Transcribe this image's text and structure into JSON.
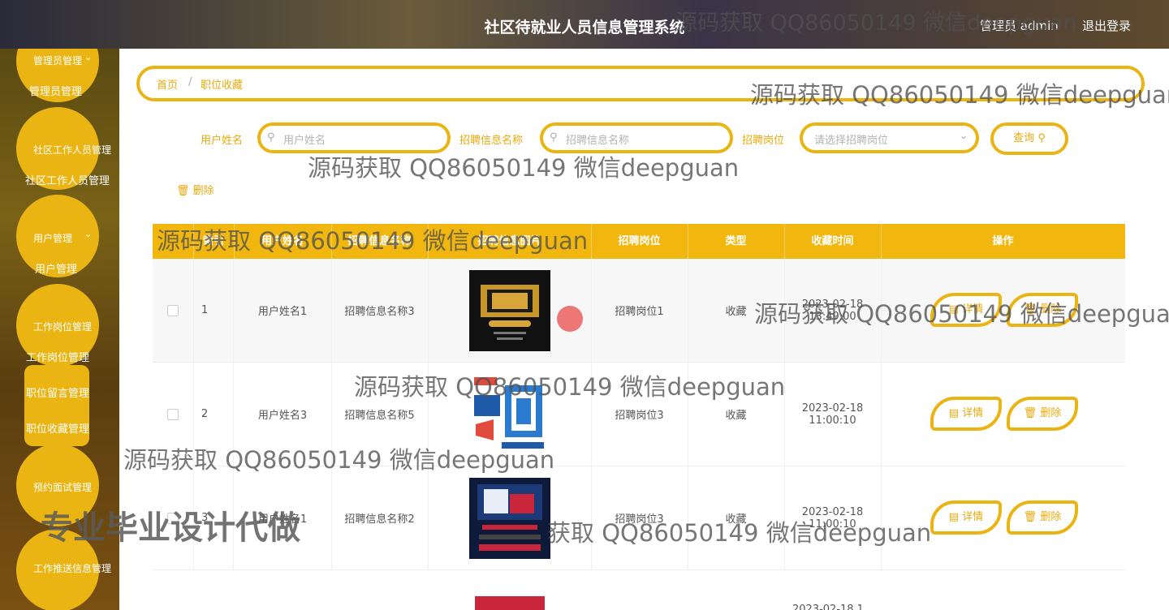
{
  "header": {
    "title": "社区待就业人员信息管理系统",
    "user": "管理员 admin",
    "logout": "退出登录"
  },
  "sidebar": {
    "items": [
      {
        "label": "管理员管理",
        "sub": "管理员管理"
      },
      {
        "label": "社区工作人员管理",
        "sub": "社区工作人员管理"
      },
      {
        "label": "用户管理",
        "sub": "用户管理"
      },
      {
        "label": "工作岗位管理",
        "sub": "工作岗位管理"
      },
      {
        "label": "职位留言管理"
      },
      {
        "label": "职位收藏管理"
      },
      {
        "label": "预约面试管理"
      },
      {
        "label": "工作推送信息管理"
      }
    ],
    "chevron": "⌄"
  },
  "breadcrumb": {
    "home": "首页",
    "sep": "/",
    "current": "职位收藏"
  },
  "filters": {
    "username_label": "用户姓名",
    "username_placeholder": "用户姓名",
    "jobinfo_label": "招聘信息名称",
    "jobinfo_placeholder": "招聘信息名称",
    "position_label": "招聘岗位",
    "position_placeholder": "请选择招聘岗位",
    "query_button": "查询",
    "delete_button": "删除"
  },
  "table": {
    "headers": [
      "",
      "索引",
      "用户姓名",
      "招聘信息名称",
      "招聘信息图片",
      "招聘岗位",
      "类型",
      "收藏时间",
      "操作"
    ],
    "rows": [
      {
        "index": "1",
        "username": "用户姓名1",
        "jobinfo": "招聘信息名称3",
        "position": "招聘岗位1",
        "type": "收藏",
        "time": "2023-02-18 13:49:00"
      },
      {
        "index": "2",
        "username": "用户姓名3",
        "jobinfo": "招聘信息名称5",
        "position": "招聘岗位3",
        "type": "收藏",
        "time": "2023-02-18 11:00:10"
      },
      {
        "index": "3",
        "username": "用户姓名1",
        "jobinfo": "招聘信息名称2",
        "position": "招聘岗位3",
        "type": "收藏",
        "time": "2023-02-18 11:00:10"
      }
    ],
    "row4_time": "2023-02-18 1",
    "detail_label": "详情",
    "delete_label": "删除"
  },
  "watermarks": {
    "text": "源码获取 QQ86050149 微信deepguan",
    "text_partial": "获取 QQ86050149 微信deepguan",
    "promo": "专业毕业设计代做"
  },
  "colors": {
    "accent": "#eab412",
    "accent_text": "#e8a90e",
    "header_row": "#f2b70e"
  }
}
